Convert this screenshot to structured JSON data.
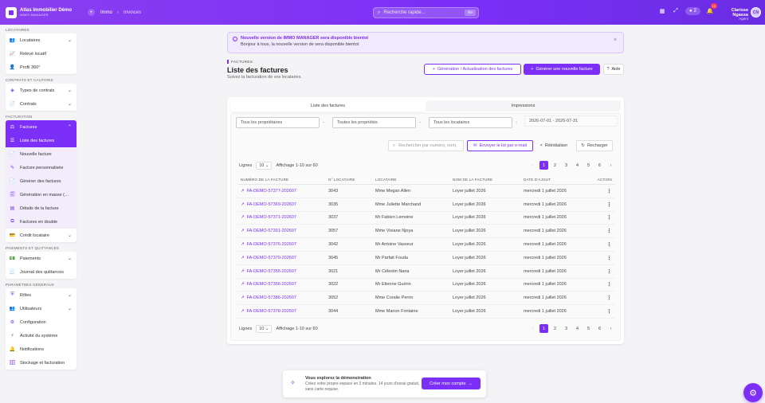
{
  "app": {
    "brand": "Atlas Immobilier Démo",
    "brand_sub": "IMMO MANAGER"
  },
  "breadcrumbs": [
    "Immo",
    "Invoices"
  ],
  "search": {
    "placeholder": "Recherche rapide...",
    "shortcut": "⌘K"
  },
  "top": {
    "coins": "2",
    "notif_badge": "10",
    "user_name": "Clarisse Ngassa",
    "user_role": "Agent",
    "avatar_initials": "CN"
  },
  "sidebar": {
    "locataires_title": "LOCATAIRES",
    "locataires": [
      {
        "label": "Locataires",
        "chevron": true
      },
      {
        "label": "Relevé locatif"
      },
      {
        "label": "Profil 360°"
      }
    ],
    "contrats_title": "CONTRATS ET CAUTIONS",
    "contrats": [
      {
        "label": "Types de contrats",
        "chevron": true
      },
      {
        "label": "Contrats",
        "chevron": true
      }
    ],
    "facturation_title": "FACTURATION",
    "factures_label": "Factures",
    "factures_sub": [
      "Liste des factures",
      "Nouvelle facture",
      "Facture personnalisée",
      "Générer des factures",
      "Génération en masse (…",
      "Détails de la facture",
      "Factures en double"
    ],
    "credit_label": "Crédit locataire",
    "paiements_title": "PAIEMENTS ET QUITTANCES",
    "paiements": [
      {
        "label": "Paiements",
        "chevron": true
      },
      {
        "label": "Journal des quittances"
      }
    ],
    "params_title": "PARAMÈTRES GÉNÉRAUX",
    "params": [
      {
        "label": "Rôles",
        "chevron": true
      },
      {
        "label": "Utilisateurs",
        "chevron": true
      },
      {
        "label": "Configuration"
      },
      {
        "label": "Activité du système"
      },
      {
        "label": "Notifications"
      },
      {
        "label": "Stockage et facturation"
      }
    ]
  },
  "notice": {
    "title": "Nouvelle version de IMMO MANAGER sera disponible bientot",
    "text": "Bonjour à tous, la nouvelle version de sera disponible bientot"
  },
  "page": {
    "eyebrow": "FACTURES",
    "title": "Liste des factures",
    "subtitle": "Suivez la facturation de vos locataires."
  },
  "actions": {
    "generate_update": "Génération / Actualisation des factures",
    "generate_new": "Générer une nouvelle facture",
    "help": "Aide"
  },
  "tabs": [
    "Liste des factures",
    "Impressions"
  ],
  "filters": {
    "owners": "Tous les propriétaires",
    "properties": "Toutes les propriétés",
    "tenants": "Tous les locataires",
    "date_range": "2026-07-01 - 2026-07-31"
  },
  "toolbar": {
    "search_placeholder": "Rechercher par numéro, nom,",
    "email_batch": "Envoyer le lot par e-mail",
    "reset": "Réinitialiser",
    "reload": "Recharger"
  },
  "pagination": {
    "lines_label": "Lignes",
    "per_page": "10",
    "range": "Affichage 1-10 sur 60",
    "pages": [
      "1",
      "2",
      "3",
      "4",
      "5",
      "6"
    ],
    "current": "1"
  },
  "table": {
    "headers": [
      "NUMÉRO DE LA FACTURE",
      "N° LOCATAIRE",
      "LOCATAIRE",
      "NOM DE LA FACTURE",
      "DATE D'AJOUT",
      "ACTION"
    ],
    "rows": [
      [
        "FA-DEMO-57377-202607",
        "3043",
        "Mme Megan Allen",
        "Loyer juillet 2026",
        "mercredi 1 juillet 2026"
      ],
      [
        "FA-DEMO-57369-202607",
        "3035",
        "Mme Juliette Marchand",
        "Loyer juillet 2026",
        "mercredi 1 juillet 2026"
      ],
      [
        "FA-DEMO-57371-202607",
        "3037",
        "Mr Fabien Lemoine",
        "Loyer juillet 2026",
        "mercredi 1 juillet 2026"
      ],
      [
        "FA-DEMO-57391-202607",
        "3057",
        "Mme Viviane Njoya",
        "Loyer juillet 2026",
        "mercredi 1 juillet 2026"
      ],
      [
        "FA-DEMO-57376-202607",
        "3042",
        "Mr Antoine Vasseur",
        "Loyer juillet 2026",
        "mercredi 1 juillet 2026"
      ],
      [
        "FA-DEMO-57379-202607",
        "3045",
        "Mr Parfait Fouda",
        "Loyer juillet 2026",
        "mercredi 1 juillet 2026"
      ],
      [
        "FA-DEMO-57355-202607",
        "3021",
        "Mr Célestin Nana",
        "Loyer juillet 2026",
        "mercredi 1 juillet 2026"
      ],
      [
        "FA-DEMO-57356-202607",
        "3022",
        "Mr Etienne Guérin",
        "Loyer juillet 2026",
        "mercredi 1 juillet 2026"
      ],
      [
        "FA-DEMO-57386-202607",
        "3052",
        "Mme Coralie Perrin",
        "Loyer juillet 2026",
        "mercredi 1 juillet 2026"
      ],
      [
        "FA-DEMO-57378-202607",
        "3044",
        "Mme Manon Fontaine",
        "Loyer juillet 2026",
        "mercredi 1 juillet 2026"
      ]
    ]
  },
  "promo": {
    "title": "Vous explorez la démonstration",
    "text": "Créez votre propre espace en 3 minutes. 14 jours d'essai gratuit, sans carte requise.",
    "button": "Créer mon compte"
  },
  "colors": {
    "accent": "#7b2ff7",
    "notice_bg": "#f1e9fe"
  },
  "icons": [
    "grid-icon",
    "expand-icon",
    "bell-icon",
    "search-icon",
    "info-icon",
    "close-icon",
    "external-link-icon",
    "mail-icon",
    "refresh-icon",
    "help-icon",
    "plus-icon",
    "chat-icon"
  ]
}
